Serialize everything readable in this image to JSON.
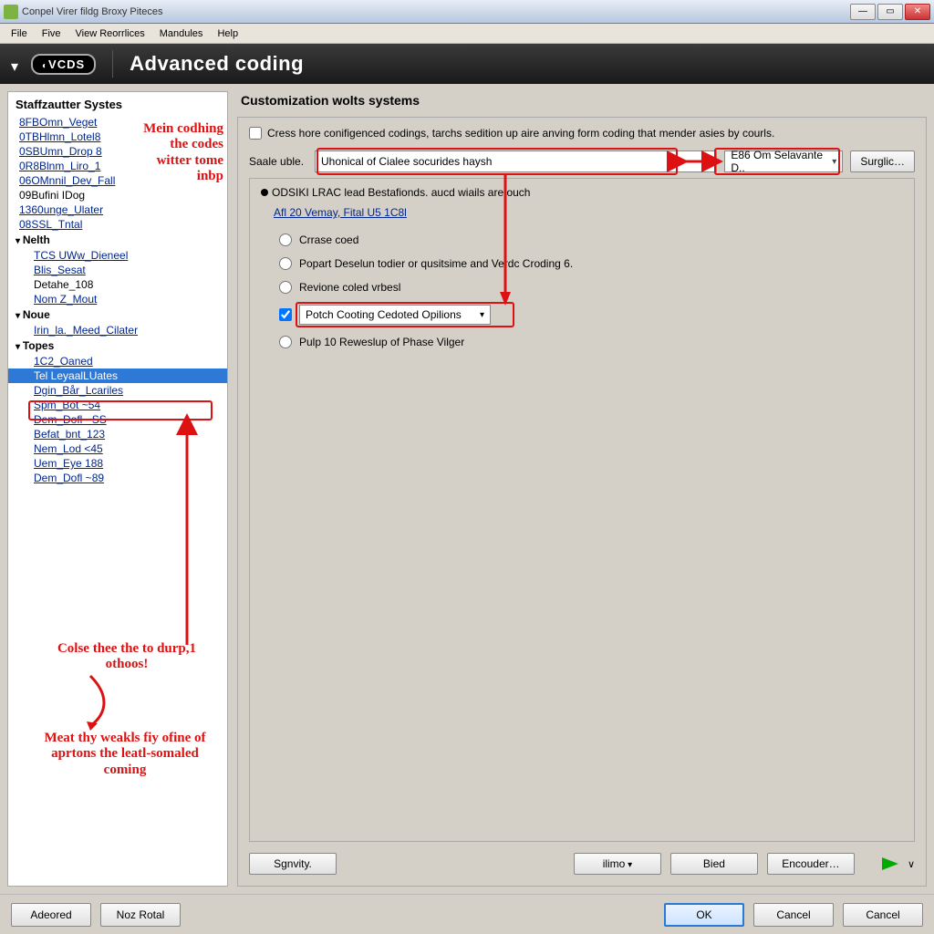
{
  "window": {
    "title": "Conpel Virer fildg Broxy Piteces"
  },
  "menu": {
    "file": "File",
    "five": "Five",
    "view": "View Reorrlices",
    "mandules": "Mandules",
    "help": "Help"
  },
  "header": {
    "logo": "VCDS",
    "title": "Advanced coding"
  },
  "sidebar": {
    "title": "Staffzautter Systes",
    "items": [
      "8FBOmn_Veget",
      "0TBHlmn_Lotel8",
      "0SBUmn_Drop 8",
      "0R8Blnm_Liro_1",
      "06OMnnil_Dev_Fall",
      "09Bufini IDog",
      "1360unge_Ulater",
      "08SSL_Tntal"
    ],
    "groups": [
      {
        "header": "Nelth",
        "items": [
          "TCS UWw_Dieneel",
          "Blis_Sesat",
          "Detahe_108",
          "Nom Z_Mout"
        ]
      },
      {
        "header": "Noue",
        "items": [
          "Irin_la._Meed_Cilater"
        ]
      },
      {
        "header": "Topes",
        "items": [
          "1C2_Oaned",
          "Tel LeyaalLUates",
          "Dgin_Bår_Lcariles",
          "Spm_Bot ~54",
          "Dem_Dofl ~SS",
          "Befat_bnt_123",
          "Nem_Lod <45",
          "Uem_Eye 188",
          "Dem_Dofl ~89"
        ],
        "selected_index": 1
      }
    ]
  },
  "annotations": {
    "a1": "Mein codhing the codes witter tome inbp",
    "a2": "Colse thee the to durp,1 othoos!",
    "a3": "Meat thy weakls fiy ofine of aprtons the leatl-somaled coming"
  },
  "panel": {
    "title": "Customization wolts systems",
    "checkbox_desc": "Cress hore conifigenced codings, tarchs sedition up aire anving form coding that mender asies by courls.",
    "select_label": "Saale uble.",
    "select_value": "Uhonical of Cialee socurides haysh",
    "small_select_value": "E86 Om Selavante D..",
    "btn_surg": "Surglic…",
    "inner_header": "ODSIKI LRAC lead Bestafionds. aucd wiails are ouch",
    "inner_link": "Afl 20 Vemay, Fital U5 1C8l",
    "radios": {
      "r1": "Crrase coed",
      "r2": "Popart Deselun todier or qusitsime and Verdc Croding 6.",
      "r3": "Revione coled vrbesl",
      "r4": "Potch Cooting Cedoted Opilions",
      "r5": "Pulp 10 Reweslup of Phase Vilger"
    },
    "buttons": {
      "sgn": "Sgnvity.",
      "ilimo": "ilimo",
      "bied": "Bied",
      "encoder": "Encouder…"
    }
  },
  "footer": {
    "adeored": "Adeored",
    "noz": "Noz Rotal",
    "ok": "OK",
    "cancel": "Cancel",
    "cancel2": "Cancel"
  }
}
